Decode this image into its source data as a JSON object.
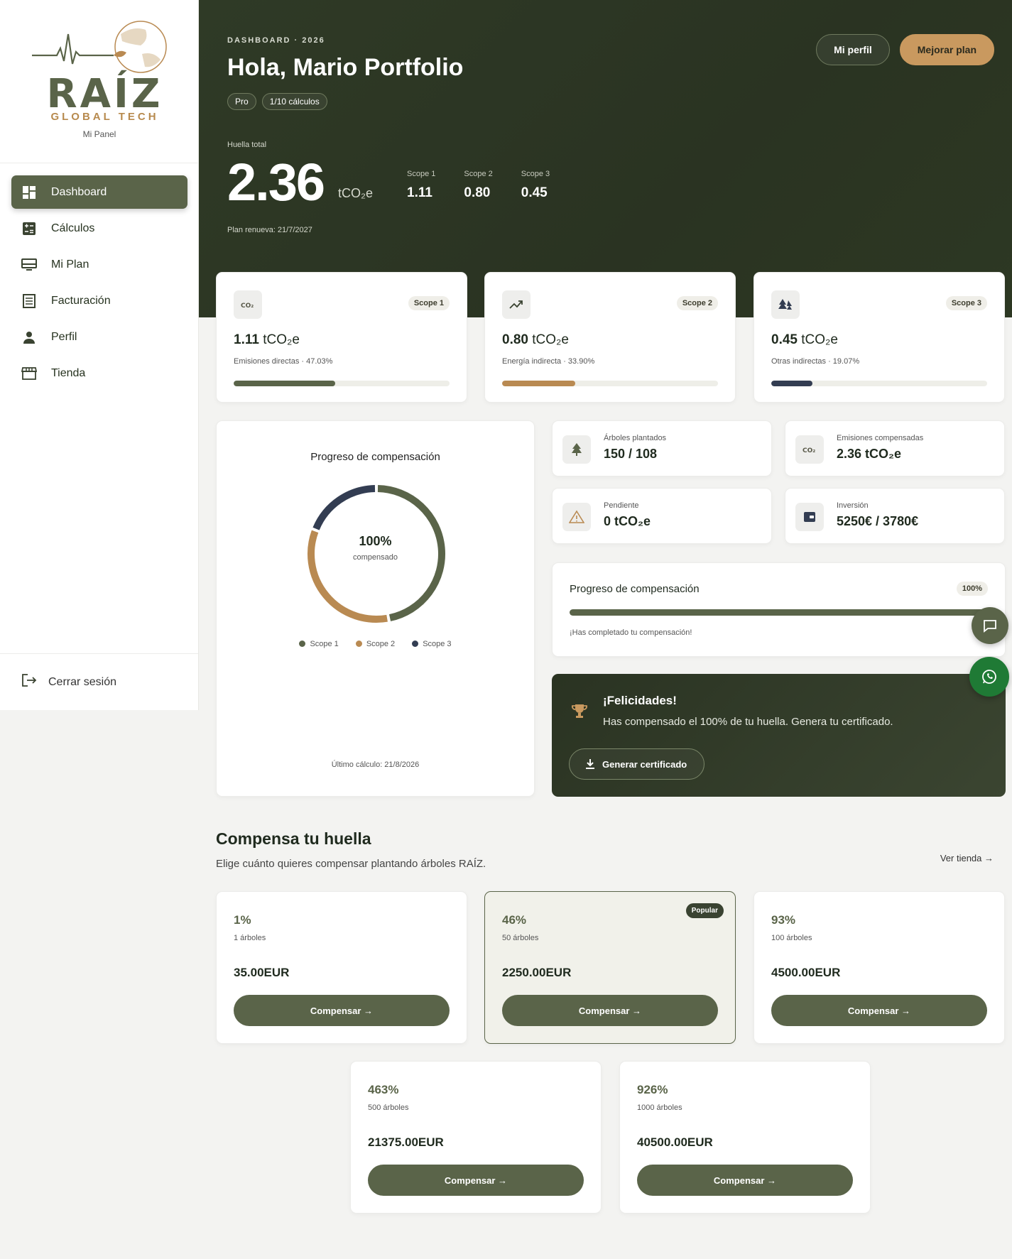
{
  "brand": {
    "name": "RAÍZ",
    "sub": "GLOBAL TECH",
    "panel": "Mi Panel"
  },
  "nav": [
    {
      "label": "Dashboard",
      "icon": "dashboard-icon",
      "active": true
    },
    {
      "label": "Cálculos",
      "icon": "calculator-icon"
    },
    {
      "label": "Mi Plan",
      "icon": "plan-icon"
    },
    {
      "label": "Facturación",
      "icon": "invoice-icon"
    },
    {
      "label": "Perfil",
      "icon": "user-icon"
    },
    {
      "label": "Tienda",
      "icon": "store-icon"
    }
  ],
  "logout": "Cerrar sesión",
  "hero": {
    "kicker": "DASHBOARD · 2026",
    "greeting": "Hola, Mario Portfolio",
    "badge_plan": "Pro",
    "badge_calcs": "1/10 cálculos",
    "btn_profile": "Mi perfil",
    "btn_upgrade": "Mejorar plan",
    "total_label": "Huella total",
    "total_value": "2.36",
    "total_unit": "tCO₂e",
    "scopes": [
      {
        "label": "Scope 1",
        "value": "1.11"
      },
      {
        "label": "Scope 2",
        "value": "0.80"
      },
      {
        "label": "Scope 3",
        "value": "0.45"
      }
    ],
    "renew": "Plan renueva: 21/7/2027"
  },
  "scope_cards": [
    {
      "tag": "Scope 1",
      "value": "1.11",
      "unit": "tCO₂e",
      "desc": "Emisiones directas · 47.03%",
      "percent": 47.03,
      "color": "#5a6449",
      "icon": "co2-icon"
    },
    {
      "tag": "Scope 2",
      "value": "0.80",
      "unit": "tCO₂e",
      "desc": "Energía indirecta · 33.90%",
      "percent": 33.9,
      "color": "#b98a52",
      "icon": "trending-up-icon"
    },
    {
      "tag": "Scope 3",
      "value": "0.45",
      "unit": "tCO₂e",
      "desc": "Otras indirectas · 19.07%",
      "percent": 19.07,
      "color": "#333d52",
      "icon": "forest-icon"
    }
  ],
  "donut": {
    "title": "Progreso de compensación",
    "center_value": "100%",
    "center_label": "compensado",
    "legend": [
      "Scope 1",
      "Scope 2",
      "Scope 3"
    ],
    "last_calc": "Último cálculo: 21/8/2026"
  },
  "chart_data": {
    "type": "pie",
    "categories": [
      "Scope 1",
      "Scope 2",
      "Scope 3"
    ],
    "values": [
      47.03,
      33.9,
      19.07
    ],
    "colors": [
      "#5a6449",
      "#b98a52",
      "#333d52"
    ]
  },
  "stats": [
    {
      "label": "Árboles plantados",
      "value": "150 / 108",
      "icon": "tree-icon"
    },
    {
      "label": "Emisiones compensadas",
      "value": "2.36 tCO₂e",
      "icon": "co2-icon"
    },
    {
      "label": "Pendiente",
      "value": "0 tCO₂e",
      "icon": "warning-icon"
    },
    {
      "label": "Inversión",
      "value": "5250€ / 3780€",
      "icon": "wallet-icon"
    }
  ],
  "progress": {
    "title": "Progreso de compensación",
    "percent_label": "100%",
    "percent": 100,
    "message": "¡Has completado tu compensación!"
  },
  "congrats": {
    "title": "¡Felicidades!",
    "text": "Has compensado el 100% de tu huella. Genera tu certificado.",
    "button": "Generar certificado"
  },
  "offset": {
    "title": "Compensa tu huella",
    "subtitle": "Elige cuánto quieres compensar plantando árboles RAÍZ.",
    "shop_link": "Ver tienda →",
    "popular_label": "Popular",
    "button_label": "Compensar →",
    "plans": [
      {
        "pct": "1%",
        "trees": "1 árboles",
        "price": "35.00EUR"
      },
      {
        "pct": "46%",
        "trees": "50 árboles",
        "price": "2250.00EUR",
        "popular": true
      },
      {
        "pct": "93%",
        "trees": "100 árboles",
        "price": "4500.00EUR"
      },
      {
        "pct": "463%",
        "trees": "500 árboles",
        "price": "21375.00EUR"
      },
      {
        "pct": "926%",
        "trees": "1000 árboles",
        "price": "40500.00EUR"
      }
    ]
  }
}
